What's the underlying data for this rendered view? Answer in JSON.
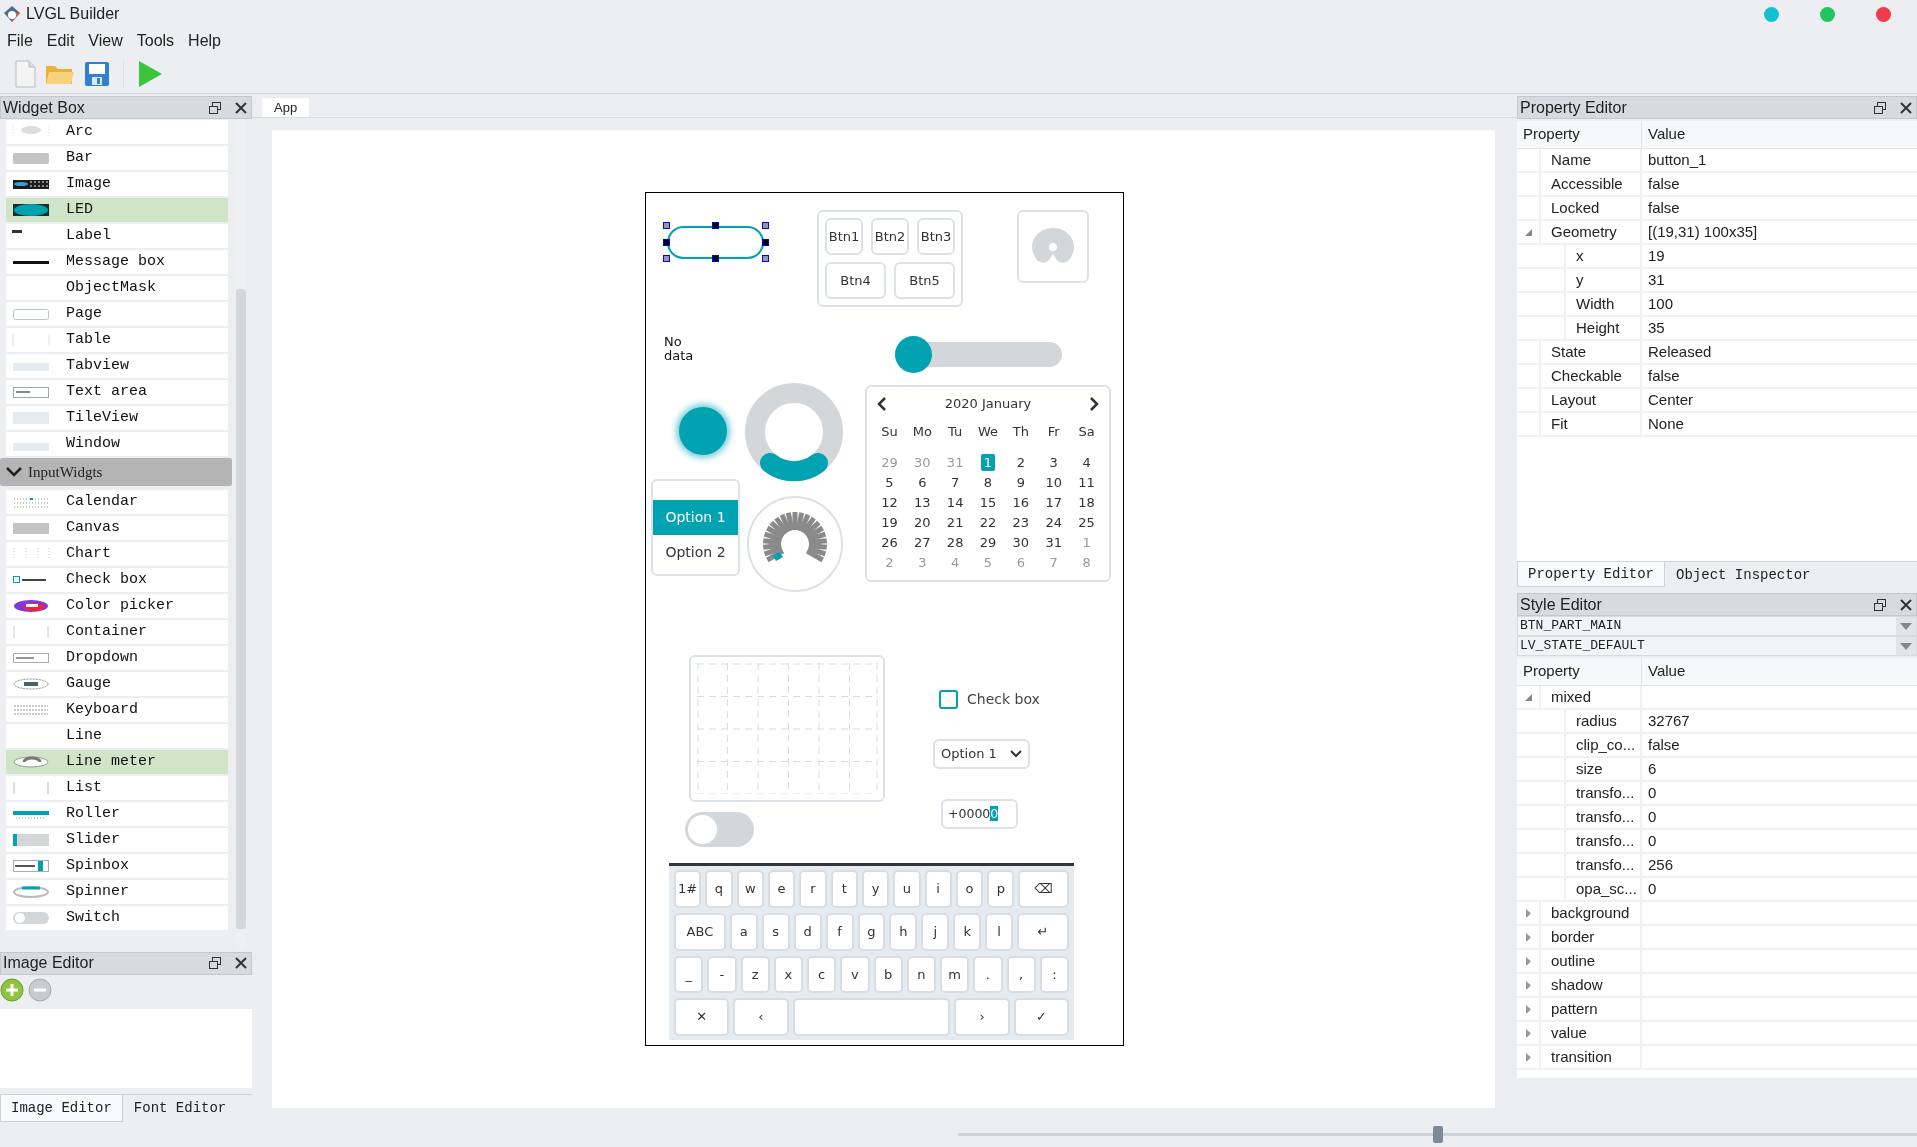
{
  "window": {
    "title": "LVGL Builder"
  },
  "menu": [
    "File",
    "Edit",
    "View",
    "Tools",
    "Help"
  ],
  "widget_box": {
    "title": "Widget Box",
    "items": [
      {
        "label": "Arc",
        "selected": false
      },
      {
        "label": "Bar",
        "selected": false
      },
      {
        "label": "Image",
        "selected": false
      },
      {
        "label": "LED",
        "selected": true
      },
      {
        "label": "Label",
        "selected": false
      },
      {
        "label": "Message box",
        "selected": false
      },
      {
        "label": "ObjectMask",
        "selected": false
      },
      {
        "label": "Page",
        "selected": false
      },
      {
        "label": "Table",
        "selected": false
      },
      {
        "label": "Tabview",
        "selected": false
      },
      {
        "label": "Text area",
        "selected": false
      },
      {
        "label": "TileView",
        "selected": false
      },
      {
        "label": "Window",
        "selected": false
      }
    ],
    "group": {
      "label": "InputWidgts",
      "expanded": true,
      "items": [
        {
          "label": "Calendar",
          "selected": false
        },
        {
          "label": "Canvas",
          "selected": false
        },
        {
          "label": "Chart",
          "selected": false
        },
        {
          "label": "Check box",
          "selected": false
        },
        {
          "label": "Color picker",
          "selected": false
        },
        {
          "label": "Container",
          "selected": false
        },
        {
          "label": "Dropdown",
          "selected": false
        },
        {
          "label": "Gauge",
          "selected": false
        },
        {
          "label": "Keyboard",
          "selected": false
        },
        {
          "label": "Line",
          "selected": false
        },
        {
          "label": "Line meter",
          "selected": true
        },
        {
          "label": "List",
          "selected": false
        },
        {
          "label": "Roller",
          "selected": false
        },
        {
          "label": "Slider",
          "selected": false
        },
        {
          "label": "Spinbox",
          "selected": false
        },
        {
          "label": "Spinner",
          "selected": false
        },
        {
          "label": "Switch",
          "selected": false
        }
      ]
    }
  },
  "image_editor": {
    "title": "Image Editor"
  },
  "left_tabs": [
    {
      "label": "Image Editor",
      "selected": true
    },
    {
      "label": "Font Editor",
      "selected": false
    }
  ],
  "editor_tabs": [
    {
      "label": "App",
      "selected": true
    }
  ],
  "screen": {
    "button": {
      "selected": true
    },
    "button_matrix": [
      [
        "Btn1",
        "Btn2",
        "Btn3"
      ],
      [
        "Btn4",
        "Btn5"
      ]
    ],
    "no_data_label": "No data",
    "slider": {
      "level": 0
    },
    "led": {
      "on": true
    },
    "roller": [
      {
        "label": "Option 1",
        "selected": true
      },
      {
        "label": "Option 2",
        "selected": false
      }
    ],
    "calendar": {
      "title": "2020 January",
      "weekdays": [
        "Su",
        "Mo",
        "Tu",
        "We",
        "Th",
        "Fr",
        "Sa"
      ],
      "weeks": [
        [
          {
            "label": "29",
            "outside": true,
            "selected": false
          },
          {
            "label": "30",
            "outside": true,
            "selected": false
          },
          {
            "label": "31",
            "outside": true,
            "selected": false
          },
          {
            "label": "1",
            "outside": false,
            "selected": true
          },
          {
            "label": "2",
            "outside": false,
            "selected": false
          },
          {
            "label": "3",
            "outside": false,
            "selected": false
          },
          {
            "label": "4",
            "outside": false,
            "selected": false
          }
        ],
        [
          {
            "label": "5",
            "outside": false,
            "selected": false
          },
          {
            "label": "6",
            "outside": false,
            "selected": false
          },
          {
            "label": "7",
            "outside": false,
            "selected": false
          },
          {
            "label": "8",
            "outside": false,
            "selected": false
          },
          {
            "label": "9",
            "outside": false,
            "selected": false
          },
          {
            "label": "10",
            "outside": false,
            "selected": false
          },
          {
            "label": "11",
            "outside": false,
            "selected": false
          }
        ],
        [
          {
            "label": "12",
            "outside": false,
            "selected": false
          },
          {
            "label": "13",
            "outside": false,
            "selected": false
          },
          {
            "label": "14",
            "outside": false,
            "selected": false
          },
          {
            "label": "15",
            "outside": false,
            "selected": false
          },
          {
            "label": "16",
            "outside": false,
            "selected": false
          },
          {
            "label": "17",
            "outside": false,
            "selected": false
          },
          {
            "label": "18",
            "outside": false,
            "selected": false
          }
        ],
        [
          {
            "label": "19",
            "outside": false,
            "selected": false
          },
          {
            "label": "20",
            "outside": false,
            "selected": false
          },
          {
            "label": "21",
            "outside": false,
            "selected": false
          },
          {
            "label": "22",
            "outside": false,
            "selected": false
          },
          {
            "label": "23",
            "outside": false,
            "selected": false
          },
          {
            "label": "24",
            "outside": false,
            "selected": false
          },
          {
            "label": "25",
            "outside": false,
            "selected": false
          }
        ],
        [
          {
            "label": "26",
            "outside": false,
            "selected": false
          },
          {
            "label": "27",
            "outside": false,
            "selected": false
          },
          {
            "label": "28",
            "outside": false,
            "selected": false
          },
          {
            "label": "29",
            "outside": false,
            "selected": false
          },
          {
            "label": "30",
            "outside": false,
            "selected": false
          },
          {
            "label": "31",
            "outside": false,
            "selected": false
          },
          {
            "label": "1",
            "outside": true,
            "selected": false
          }
        ],
        [
          {
            "label": "2",
            "outside": true,
            "selected": false
          },
          {
            "label": "3",
            "outside": true,
            "selected": false
          },
          {
            "label": "4",
            "outside": true,
            "selected": false
          },
          {
            "label": "5",
            "outside": true,
            "selected": false
          },
          {
            "label": "6",
            "outside": true,
            "selected": false
          },
          {
            "label": "7",
            "outside": true,
            "selected": false
          },
          {
            "label": "8",
            "outside": true,
            "selected": false
          }
        ]
      ]
    },
    "checkbox": {
      "label": "Check box",
      "checked": false
    },
    "dropdown": {
      "value": "Option 1"
    },
    "spinbox": {
      "value": "+00000"
    },
    "switch": {
      "on": false
    },
    "keyboard": [
      [
        {
          "label": "1#",
          "kind": "char"
        },
        {
          "label": "q",
          "kind": "char"
        },
        {
          "label": "w",
          "kind": "char"
        },
        {
          "label": "e",
          "kind": "char"
        },
        {
          "label": "r",
          "kind": "char"
        },
        {
          "label": "t",
          "kind": "char"
        },
        {
          "label": "y",
          "kind": "char"
        },
        {
          "label": "u",
          "kind": "char"
        },
        {
          "label": "i",
          "kind": "char"
        },
        {
          "label": "o",
          "kind": "char"
        },
        {
          "label": "p",
          "kind": "char"
        },
        {
          "label": "⌫",
          "kind": "wide"
        }
      ],
      [
        {
          "label": "ABC",
          "kind": "wide"
        },
        {
          "label": "a",
          "kind": "char"
        },
        {
          "label": "s",
          "kind": "char"
        },
        {
          "label": "d",
          "kind": "char"
        },
        {
          "label": "f",
          "kind": "char"
        },
        {
          "label": "g",
          "kind": "char"
        },
        {
          "label": "h",
          "kind": "char"
        },
        {
          "label": "j",
          "kind": "char"
        },
        {
          "label": "k",
          "kind": "char"
        },
        {
          "label": "l",
          "kind": "char"
        },
        {
          "label": "↵",
          "kind": "wide"
        }
      ],
      [
        {
          "label": "_",
          "kind": "char"
        },
        {
          "label": "-",
          "kind": "char"
        },
        {
          "label": "z",
          "kind": "char"
        },
        {
          "label": "x",
          "kind": "char"
        },
        {
          "label": "c",
          "kind": "char"
        },
        {
          "label": "v",
          "kind": "char"
        },
        {
          "label": "b",
          "kind": "char"
        },
        {
          "label": "n",
          "kind": "char"
        },
        {
          "label": "m",
          "kind": "char"
        },
        {
          "label": ".",
          "kind": "char"
        },
        {
          "label": ",",
          "kind": "char"
        },
        {
          "label": ":",
          "kind": "char"
        }
      ],
      [
        {
          "label": "✕",
          "kind": "char"
        },
        {
          "label": "‹",
          "kind": "char"
        },
        {
          "kind": "space"
        },
        {
          "label": "›",
          "kind": "char"
        },
        {
          "label": "✓",
          "kind": "char"
        }
      ]
    ]
  },
  "property_editor": {
    "title": "Property Editor",
    "columns": [
      "Property",
      "Value"
    ],
    "rows": [
      {
        "property": "Name",
        "value": "button_1"
      },
      {
        "property": "Accessible",
        "value": "false"
      },
      {
        "property": "Locked",
        "value": "false"
      },
      {
        "property": "Geometry",
        "value": "[(19,31) 100x35]",
        "expanded": true,
        "children": [
          {
            "property": "x",
            "value": "19"
          },
          {
            "property": "y",
            "value": "31"
          },
          {
            "property": "Width",
            "value": "100"
          },
          {
            "property": "Height",
            "value": "35"
          }
        ]
      },
      {
        "property": "State",
        "value": "Released"
      },
      {
        "property": "Checkable",
        "value": "false"
      },
      {
        "property": "Layout",
        "value": "Center"
      },
      {
        "property": "Fit",
        "value": "None"
      }
    ]
  },
  "right_tabs": [
    {
      "label": "Property Editor",
      "selected": true
    },
    {
      "label": "Object Inspector",
      "selected": false
    }
  ],
  "style_editor": {
    "title": "Style Editor",
    "part": "BTN_PART_MAIN",
    "state": "LV_STATE_DEFAULT",
    "columns": [
      "Property",
      "Value"
    ],
    "rows": [
      {
        "property": "mixed",
        "expanded": true,
        "children": [
          {
            "property": "radius",
            "value": "32767"
          },
          {
            "property": "clip_co...",
            "value": "false"
          },
          {
            "property": "size",
            "value": "6"
          },
          {
            "property": "transfo...",
            "value": "0"
          },
          {
            "property": "transfo...",
            "value": "0"
          },
          {
            "property": "transfo...",
            "value": "0"
          },
          {
            "property": "transfo...",
            "value": "256"
          },
          {
            "property": "opa_sc...",
            "value": "0"
          }
        ]
      },
      {
        "property": "background",
        "expanded": false
      },
      {
        "property": "border",
        "expanded": false
      },
      {
        "property": "outline",
        "expanded": false
      },
      {
        "property": "shadow",
        "expanded": false
      },
      {
        "property": "pattern",
        "expanded": false
      },
      {
        "property": "value",
        "expanded": false
      },
      {
        "property": "transition",
        "expanded": false
      }
    ]
  },
  "zoom": {
    "level": 0.5
  }
}
